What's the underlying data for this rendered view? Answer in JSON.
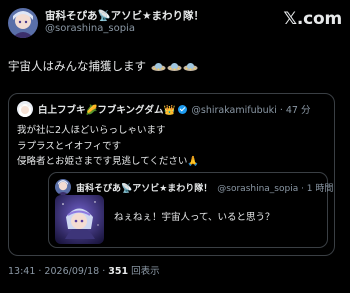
{
  "main_tweet": {
    "author_name": "宙科そぴあ📡アソビ★まわり隊！",
    "handle": "@sorashina_sopia",
    "text": "宇宙人はみんな捕獲します"
  },
  "brand": {
    "label": "𝕏.com"
  },
  "quoted_tweet": {
    "author_name": "白上フブキ🌽フブキングダム👑",
    "meta": "@shirakamifubuki · 47 分",
    "lines": [
      "我が社に2人ほどいらっしゃいます",
      "ラプラスとイオフィです",
      "侵略者とお姫さまです見逃してください🙏"
    ]
  },
  "nested_tweet": {
    "author_name": "宙科そぴあ📡アソビ★まわり隊！",
    "meta": "@sorashina_sopia · 1 時間",
    "text": "ねぇねぇ！宇宙人って、いると思う？"
  },
  "footer": {
    "timestamp": "13:41 · 2026/09/18 · ",
    "views_count": "351",
    "views_label": " 回表示"
  },
  "icons": {
    "ufo": "flying-saucer-emoji",
    "verified": "verified-badge-icon"
  },
  "colors": {
    "background": "#000000",
    "text": "#e7e9ea",
    "muted": "#8b98a5",
    "border": "#3a3f44",
    "verified": "#1d9bf0"
  }
}
